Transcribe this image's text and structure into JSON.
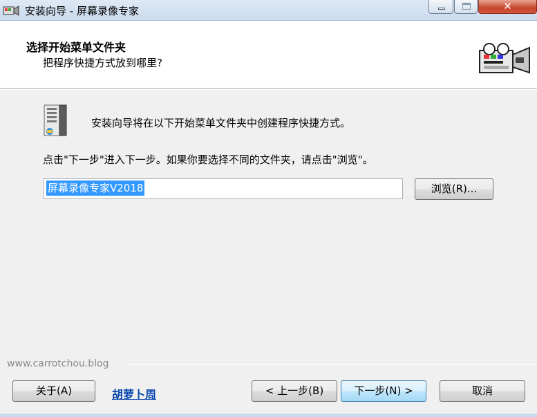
{
  "window": {
    "title": "安装向导 - 屏幕录像专家",
    "app_icon": "camera-icon",
    "controls": {
      "minimize": "minimize-icon",
      "maximize": "maximize-icon",
      "close": "✕"
    }
  },
  "header": {
    "title": "选择开始菜单文件夹",
    "subtitle": "把程序快捷方式放到哪里?",
    "icon": "video-camera-icon"
  },
  "main": {
    "icon": "start-menu-folder-icon",
    "intro": "安装向导将在以下开始菜单文件夹中创建程序快捷方式。",
    "instruction": "点击\"下一步\"进入下一步。如果你要选择不同的文件夹，请点击\"浏览\"。",
    "folder_value": "屏幕录像专家V2018",
    "browse_label": "浏览",
    "browse_accel": "(R)...",
    "browse_accel_key": "R"
  },
  "footer": {
    "watermark": "www.carrotchou.blog",
    "about_label": "关于",
    "about_accel": "(A)",
    "author_link": "胡萝卜周",
    "back_label": "< 上一步",
    "back_accel": "(B)",
    "next_label": "下一步",
    "next_accel": "(N) >",
    "cancel_label": "取消"
  },
  "colors": {
    "titlebar": "#c9dbee",
    "dialog_bg": "#f0f0f0",
    "selection": "#3399ff",
    "link": "#0645ad",
    "close_button": "#c7452c"
  }
}
